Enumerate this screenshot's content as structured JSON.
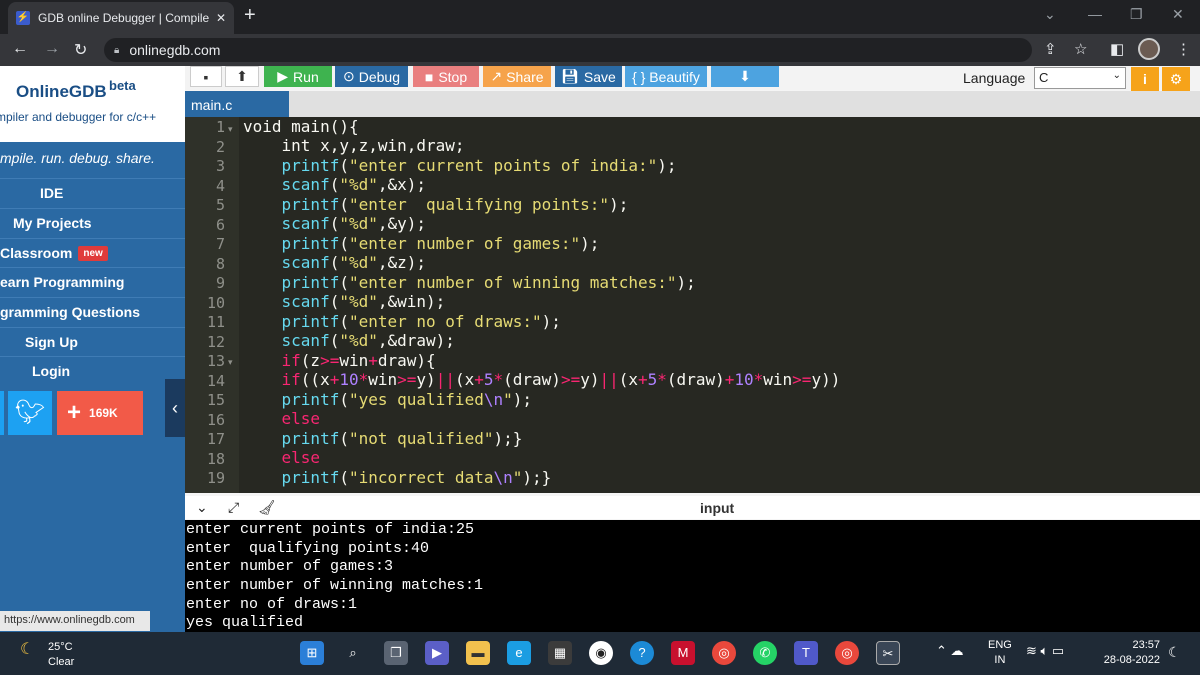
{
  "browser": {
    "tab_title": "GDB online Debugger | Compiler",
    "tab_close": "✕",
    "new_tab": "+",
    "url": "onlinegdb.com"
  },
  "site": {
    "name": "OnlineGDB",
    "beta": "beta",
    "subtitle": "mpiler and debugger for c/c++",
    "tagline": "mpile. run. debug. share.",
    "menu": [
      {
        "label": "IDE"
      },
      {
        "label": "My Projects"
      },
      {
        "label": "Classroom",
        "badge": "new"
      },
      {
        "label": "earn Programming"
      },
      {
        "label": "gramming Questions"
      },
      {
        "label": "Sign Up"
      },
      {
        "label": "Login"
      }
    ],
    "share_count": "169K",
    "status_url": "https://www.onlinegdb.com"
  },
  "toolbar": {
    "run": "Run",
    "debug": "Debug",
    "stop": "Stop",
    "share": "Share",
    "save": "Save",
    "beautify": "{ } Beautify",
    "language_label": "Language",
    "language_value": "C"
  },
  "editor": {
    "filename": "main.c",
    "line_numbers": [
      "1",
      "2",
      "3",
      "4",
      "5",
      "6",
      "7",
      "8",
      "9",
      "10",
      "11",
      "12",
      "13",
      "14",
      "15",
      "16",
      "17",
      "18",
      "19"
    ]
  },
  "panel": {
    "label": "input"
  },
  "console": {
    "lines": [
      "enter current points of india:25",
      "enter  qualifying points:40",
      "enter number of games:3",
      "enter number of winning matches:1",
      "enter no of draws:1",
      "yes qualified"
    ]
  },
  "taskbar": {
    "temperature": "25°C",
    "weather": "Clear",
    "lang_top": "ENG",
    "lang_bottom": "IN",
    "time": "23:57",
    "date": "28-08-2022"
  },
  "colors": {
    "sidebar": "#2a69a3",
    "editor_bg": "#272822",
    "run": "#3eb34f",
    "debug": "#2a69a3",
    "stop": "#e97f7f",
    "share": "#f6a34b",
    "save": "#2a69a3",
    "beautify": "#4da3e0"
  }
}
